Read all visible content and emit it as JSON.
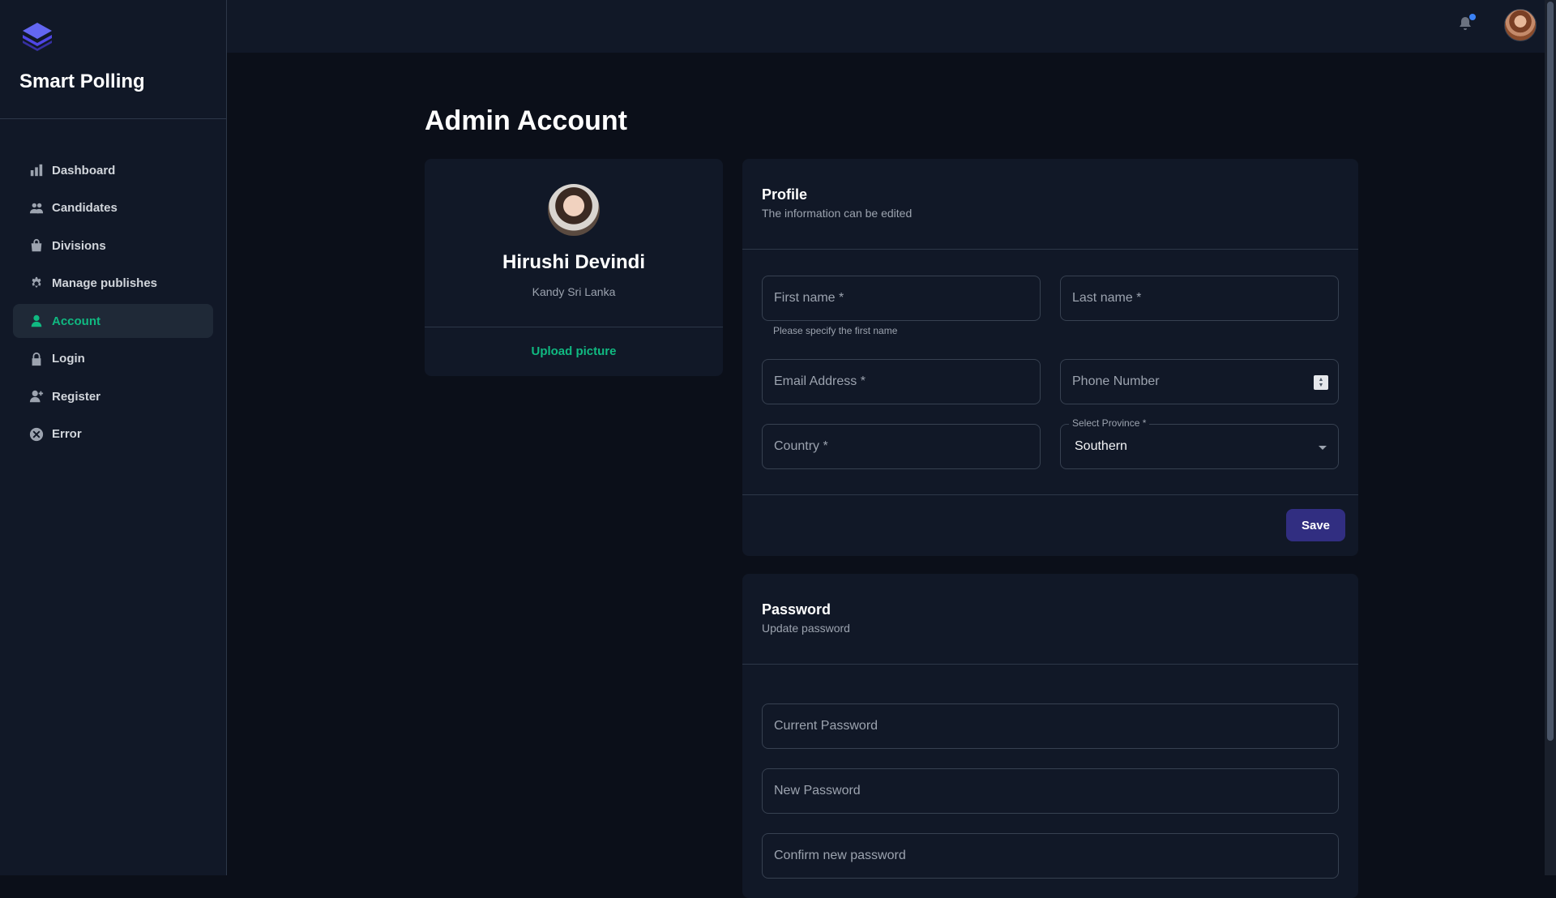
{
  "app": {
    "name": "Smart Polling"
  },
  "sidebar": {
    "items": [
      {
        "label": "Dashboard",
        "icon": "chart-bar-icon",
        "active": false
      },
      {
        "label": "Candidates",
        "icon": "users-icon",
        "active": false
      },
      {
        "label": "Divisions",
        "icon": "shopping-bag-icon",
        "active": false
      },
      {
        "label": "Manage publishes",
        "icon": "gear-icon",
        "active": false
      },
      {
        "label": "Account",
        "icon": "user-icon",
        "active": true
      },
      {
        "label": "Login",
        "icon": "lock-icon",
        "active": false
      },
      {
        "label": "Register",
        "icon": "user-add-icon",
        "active": false
      },
      {
        "label": "Error",
        "icon": "x-circle-icon",
        "active": false
      }
    ]
  },
  "topbar": {
    "notification_badge": true
  },
  "page": {
    "title": "Admin Account"
  },
  "profile_card": {
    "name": "Hirushi Devindi",
    "location": "Kandy Sri Lanka",
    "upload_label": "Upload picture"
  },
  "profile_form": {
    "title": "Profile",
    "subtitle": "The information can be edited",
    "first_name": {
      "placeholder": "First name *",
      "helper": "Please specify the first name"
    },
    "last_name": {
      "placeholder": "Last name *"
    },
    "email": {
      "placeholder": "Email Address *"
    },
    "phone": {
      "placeholder": "Phone Number"
    },
    "country": {
      "placeholder": "Country *"
    },
    "province": {
      "label": "Select Province *",
      "value": "Southern"
    },
    "save_label": "Save"
  },
  "password_form": {
    "title": "Password",
    "subtitle": "Update password",
    "current": {
      "placeholder": "Current Password"
    },
    "new": {
      "placeholder": "New Password"
    },
    "confirm": {
      "placeholder": "Confirm new password"
    }
  },
  "colors": {
    "accent": "#10b981",
    "primary_button": "#312e81",
    "background": "#0b0f19",
    "panel": "#111827",
    "notification_dot": "#3b82f6"
  }
}
